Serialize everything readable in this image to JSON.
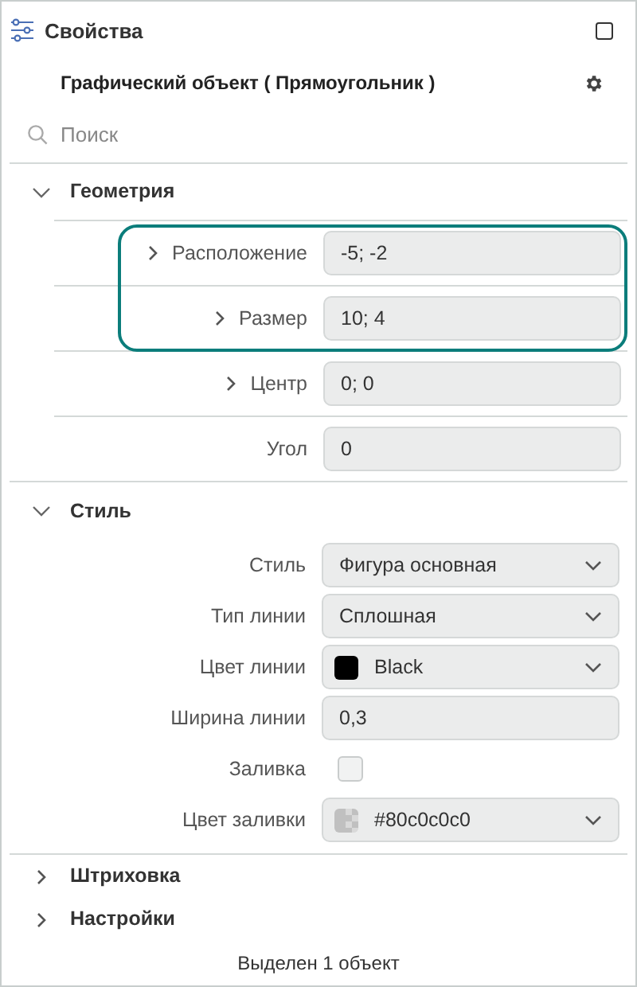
{
  "panel": {
    "title": "Свойства"
  },
  "object_title": "Графический объект ( Прямоугольник )",
  "search": {
    "placeholder": "Поиск"
  },
  "sections": [
    {
      "title": "Геометрия",
      "expanded": true,
      "rows": [
        {
          "kind": "text",
          "label": "Расположение",
          "value": "-5; -2",
          "expandable": true,
          "highlighted": true
        },
        {
          "kind": "text",
          "label": "Размер",
          "value": "10; 4",
          "expandable": true,
          "highlighted": true
        },
        {
          "kind": "text",
          "label": "Центр",
          "value": "0; 0",
          "expandable": true,
          "highlighted": false
        },
        {
          "kind": "text",
          "label": "Угол",
          "value": "0",
          "expandable": false,
          "highlighted": false
        }
      ]
    },
    {
      "title": "Стиль",
      "expanded": true,
      "rows": [
        {
          "kind": "dropdown",
          "label": "Стиль",
          "value": "Фигура основная",
          "expandable": false,
          "highlighted": false
        },
        {
          "kind": "dropdown",
          "label": "Тип линии",
          "value": "Сплошная",
          "expandable": false,
          "highlighted": false
        },
        {
          "kind": "color",
          "label": "Цвет линии",
          "value": "Black",
          "color": "#000000",
          "expandable": false,
          "highlighted": false
        },
        {
          "kind": "text",
          "label": "Ширина линии",
          "value": "0,3",
          "expandable": false,
          "highlighted": false
        },
        {
          "kind": "checkbox",
          "label": "Заливка",
          "checked": false,
          "expandable": false,
          "highlighted": false
        },
        {
          "kind": "color",
          "label": "Цвет заливки",
          "value": "#80c0c0c0",
          "color": "#c0c0c0",
          "expandable": false,
          "highlighted": false
        }
      ]
    },
    {
      "title": "Штриховка",
      "expanded": false
    },
    {
      "title": "Настройки",
      "expanded": false
    }
  ],
  "status": "Выделен 1 объект"
}
